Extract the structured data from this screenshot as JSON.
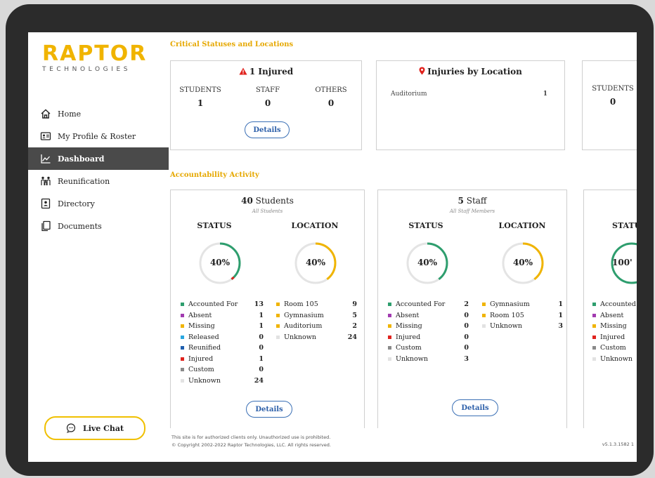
{
  "logo": {
    "word": "RAPTOR",
    "sub": "TECHNOLOGIES"
  },
  "nav": [
    {
      "label": "Home",
      "icon": "home-icon",
      "active": false
    },
    {
      "label": "My Profile & Roster",
      "icon": "profile-card-icon",
      "active": false
    },
    {
      "label": "Dashboard",
      "icon": "chart-line-icon",
      "active": true
    },
    {
      "label": "Reunification",
      "icon": "family-icon",
      "active": false
    },
    {
      "label": "Directory",
      "icon": "contact-book-icon",
      "active": false
    },
    {
      "label": "Documents",
      "icon": "documents-icon",
      "active": false
    }
  ],
  "live_chat": {
    "label": "Live Chat",
    "icon": "chat-bubble-icon"
  },
  "critical": {
    "title": "Critical Statuses and Locations",
    "injured_card": {
      "heading": "1 Injured",
      "icon": "warning-triangle-icon",
      "stats": [
        {
          "label": "STUDENTS",
          "value": "1"
        },
        {
          "label": "STAFF",
          "value": "0"
        },
        {
          "label": "OTHERS",
          "value": "0"
        }
      ],
      "button": "Details"
    },
    "location_card": {
      "heading": "Injuries by Location",
      "icon": "map-pin-icon",
      "rows": [
        {
          "name": "Auditorium",
          "value": "1"
        }
      ]
    },
    "third_card": {
      "label": "STUDENTS",
      "value": "0"
    }
  },
  "accountability": {
    "title": "Accountability Activity",
    "students": {
      "count": "40",
      "noun": "Students",
      "subtitle": "All Students",
      "status_head": "STATUS",
      "location_head": "LOCATION",
      "status_pct": 40,
      "location_pct": 40,
      "status_label": "40%",
      "location_label": "40%",
      "status_legend": [
        {
          "name": "Accounted For",
          "value": "13",
          "color": "#2e9e6e"
        },
        {
          "name": "Absent",
          "value": "1",
          "color": "#a23bb0"
        },
        {
          "name": "Missing",
          "value": "1",
          "color": "#f0b400"
        },
        {
          "name": "Released",
          "value": "0",
          "color": "#2aa7e0"
        },
        {
          "name": "Reunified",
          "value": "0",
          "color": "#1f5fae"
        },
        {
          "name": "Injured",
          "value": "1",
          "color": "#e0231e"
        },
        {
          "name": "Custom",
          "value": "0",
          "color": "#8a8a8a"
        },
        {
          "name": "Unknown",
          "value": "24",
          "color": "#e2e2e2"
        }
      ],
      "location_legend": [
        {
          "name": "Room 105",
          "value": "9",
          "color": "#f0b400"
        },
        {
          "name": "Gymnasium",
          "value": "5",
          "color": "#f0b400"
        },
        {
          "name": "Auditorium",
          "value": "2",
          "color": "#f0b400"
        },
        {
          "name": "Unknown",
          "value": "24",
          "color": "#e2e2e2"
        }
      ],
      "button": "Details"
    },
    "staff": {
      "count": "5",
      "noun": "Staff",
      "subtitle": "All Staff Members",
      "status_head": "STATUS",
      "location_head": "LOCATION",
      "status_pct": 40,
      "location_pct": 40,
      "status_label": "40%",
      "location_label": "40%",
      "status_legend": [
        {
          "name": "Accounted For",
          "value": "2",
          "color": "#2e9e6e"
        },
        {
          "name": "Absent",
          "value": "0",
          "color": "#a23bb0"
        },
        {
          "name": "Missing",
          "value": "0",
          "color": "#f0b400"
        },
        {
          "name": "Injured",
          "value": "0",
          "color": "#e0231e"
        },
        {
          "name": "Custom",
          "value": "0",
          "color": "#8a8a8a"
        },
        {
          "name": "Unknown",
          "value": "3",
          "color": "#e2e2e2"
        }
      ],
      "location_legend": [
        {
          "name": "Gymnasium",
          "value": "1",
          "color": "#f0b400"
        },
        {
          "name": "Room 105",
          "value": "1",
          "color": "#f0b400"
        },
        {
          "name": "Unknown",
          "value": "3",
          "color": "#e2e2e2"
        }
      ],
      "button": "Details"
    },
    "third": {
      "status_head": "STATU",
      "ring_pct": 100,
      "ring_label": "100'",
      "legend": [
        {
          "name": "Accounted",
          "color": "#2e9e6e"
        },
        {
          "name": "Absent",
          "color": "#a23bb0"
        },
        {
          "name": "Missing",
          "color": "#f0b400"
        },
        {
          "name": "Injured",
          "color": "#e0231e"
        },
        {
          "name": "Custom",
          "color": "#8a8a8a"
        },
        {
          "name": "Unknown",
          "color": "#e2e2e2"
        }
      ]
    }
  },
  "footer": {
    "line1": "This site is for authorized clients only. Unauthorized use is prohibited.",
    "line2": "© Copyright 2002-2022 Raptor Technologies, LLC. All rights reserved.",
    "version": "v5.1.3.1582  1"
  },
  "colors": {
    "accent": "#f0b400",
    "status_ring": "#2e9e6e",
    "location_ring": "#f0b400",
    "button": "#2b5ea8"
  }
}
